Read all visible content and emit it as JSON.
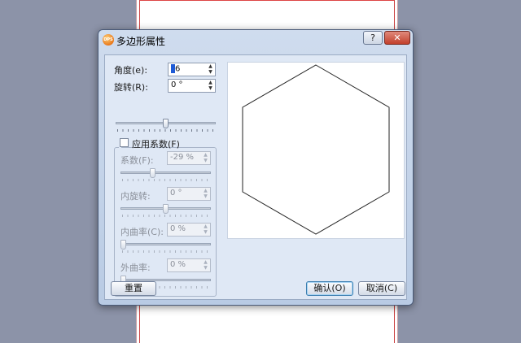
{
  "dialog": {
    "title": "多边形属性",
    "icon_text": "DPS",
    "help_label": "?",
    "close_label": "✕",
    "colors": {
      "accent": "#1e5bd6",
      "titlebar": "#c4d4ea"
    }
  },
  "fields": {
    "corners_label": "角度(e):",
    "corners_value": "6",
    "rotation_label": "旋转(R):",
    "rotation_value": "0 °"
  },
  "factor_group": {
    "checkbox_label": "应用系数(F)",
    "checked": false,
    "factor_label": "系数(F):",
    "factor_value": "-29 %",
    "inner_rotation_label": "内旋转:",
    "inner_rotation_value": "0 °",
    "inner_curve_label": "内曲率(C):",
    "inner_curve_value": "0 %",
    "outer_curve_label": "外曲率:",
    "outer_curve_value": "0 %"
  },
  "sliders": {
    "rotation_level": 0.5,
    "factor_level": 0.35,
    "inner_rotation_level": 0.5,
    "inner_curve_level": 0.0,
    "outer_curve_level": 0.0
  },
  "buttons": {
    "reset_label": "重置",
    "ok_label": "确认(O)",
    "cancel_label": "取消(C)"
  },
  "icons": {
    "spin_up": "▲",
    "spin_down": "▼"
  }
}
